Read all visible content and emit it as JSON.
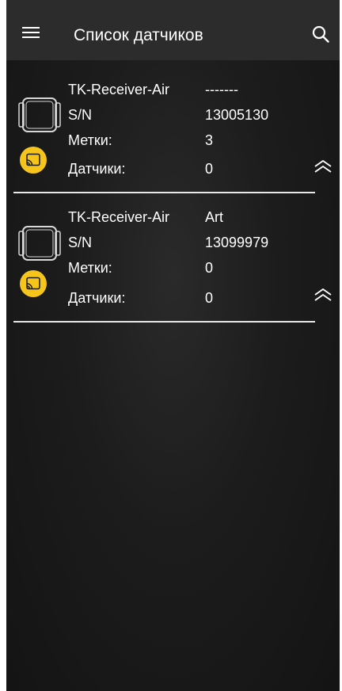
{
  "app_bar": {
    "title": "Список датчиков",
    "menu_icon": "hamburger-menu-icon",
    "search_icon": "search-icon"
  },
  "colors": {
    "app_bar_bg": "#2c2c2c",
    "background": "#1c1c1c",
    "accent": "#f5c51c",
    "text": "#ffffff"
  },
  "receivers": [
    {
      "model": "TK-Receiver-Air",
      "name": "-------",
      "sn_label": "S/N",
      "sn": "13005130",
      "tags_label": "Метки:",
      "tags": "3",
      "sensors_label": "Датчики:",
      "sensors": "0"
    },
    {
      "model": "TK-Receiver-Air",
      "name": "Art",
      "sn_label": "S/N",
      "sn": "13099979",
      "tags_label": "Метки:",
      "tags": "0",
      "sensors_label": "Датчики:",
      "sensors": "0"
    }
  ]
}
